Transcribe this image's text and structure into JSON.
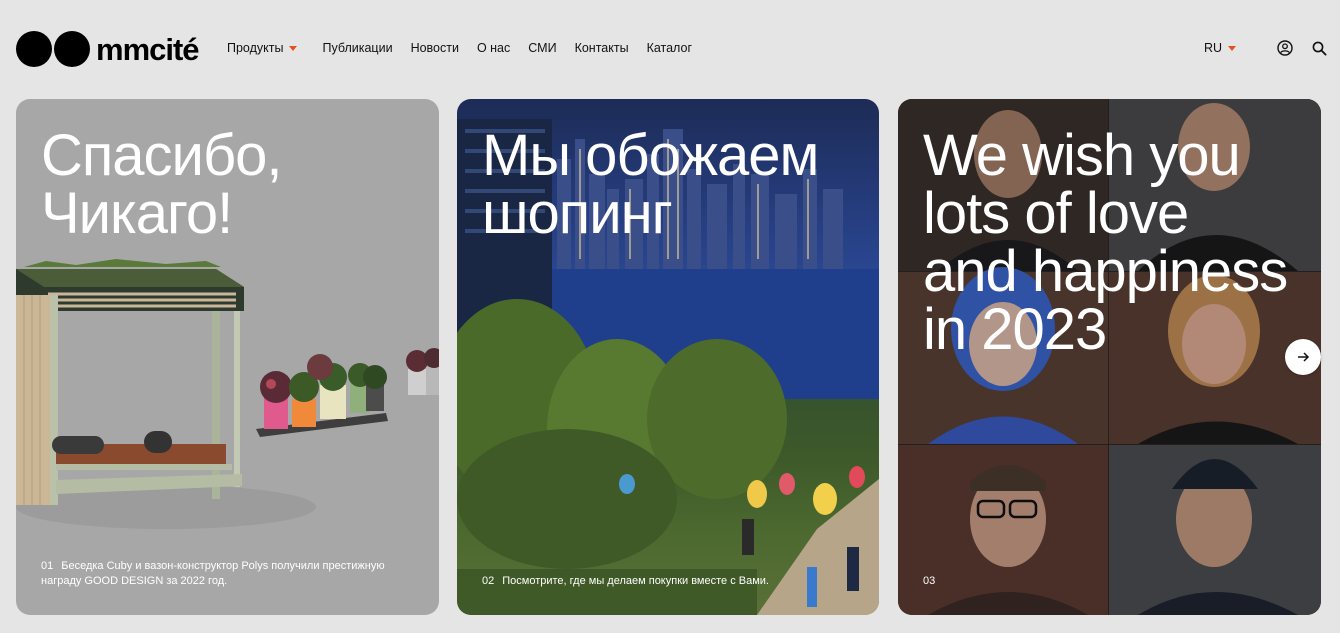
{
  "logo": {
    "text": "mmcité"
  },
  "nav": {
    "items": [
      {
        "label": "Продукты",
        "has_dropdown": true
      },
      {
        "label": "Публикации"
      },
      {
        "label": "Новости"
      },
      {
        "label": "О нас"
      },
      {
        "label": "СМИ"
      },
      {
        "label": "Контакты"
      },
      {
        "label": "Каталог"
      }
    ]
  },
  "tools": {
    "lang": "RU",
    "icons": [
      "user-icon",
      "search-icon"
    ]
  },
  "colors": {
    "accent": "#e8501e",
    "card1_bg": "#a7a7a7",
    "page_bg": "#e5e5e5"
  },
  "slides": [
    {
      "title_lines": [
        "Спасибо,",
        "Чикаго!"
      ],
      "num": "01",
      "caption": "Беседка Cuby и вазон-конструктор Polys получили престижную награду GOOD DESIGN за 2022 год."
    },
    {
      "title_lines": [
        "Мы обожаем",
        "шопинг"
      ],
      "num": "02",
      "caption": "Посмотрите, где мы делаем покупки вместе с Вами."
    },
    {
      "title_lines": [
        "We wish you",
        "lots of love",
        "and happiness",
        "in 2023"
      ],
      "num": "03",
      "caption": ""
    }
  ]
}
